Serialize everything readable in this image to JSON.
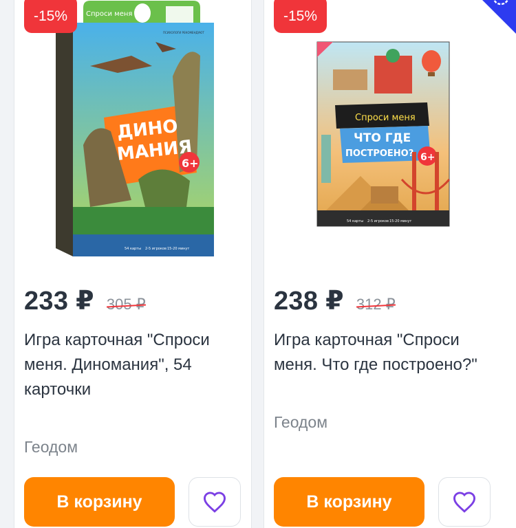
{
  "products": [
    {
      "discount": "-15%",
      "price": "233 ₽",
      "old_price": "305 ₽",
      "title": "Игра карточная \"Спроси меня. Диномания\", 54 карточки",
      "brand": "Геодом",
      "cart_label": "В корзину",
      "box": {
        "top_tag": "Спроси меня",
        "logo_text": "ПСИХОЛОГИ РЕКОМЕНДУЮТ",
        "name_line1": "ДИНО",
        "name_line2": "МАНИЯ",
        "age": "6+",
        "info": [
          "54 карты",
          "2-5 игроков",
          "15-20 минут"
        ]
      }
    },
    {
      "discount": "-15%",
      "price": "238 ₽",
      "old_price": "312 ₽",
      "title": "Игра карточная \"Спроси меня. Что где построено?\"",
      "brand": "Геодом",
      "cart_label": "В корзину",
      "box": {
        "top_tag": "Спроси меня",
        "name_line1": "ЧТО ГДЕ",
        "name_line2": "ПОСТРОЕНО?",
        "age": "6+",
        "info": [
          "54 карты",
          "2-5 игроков",
          "15-20 минут"
        ]
      }
    }
  ],
  "colors": {
    "discount": "#f0353a",
    "cart_button": "#ff8500",
    "heart": "#7b3fe4",
    "corner_badge": "#2d3bf0"
  },
  "icons": {
    "favorite": "heart-outline-icon",
    "corner": "discount-badge-icon"
  }
}
